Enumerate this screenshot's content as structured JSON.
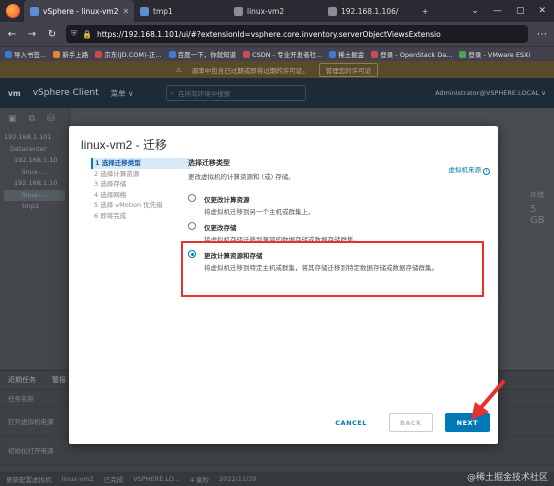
{
  "browser": {
    "tabs": [
      {
        "label": "vSphere - linux-vm2",
        "active": true
      },
      {
        "label": "tmp1"
      },
      {
        "label": "linux-vm2"
      },
      {
        "label": "192.168.1.106/"
      }
    ],
    "new_tab": "+",
    "window_controls": [
      "⌄",
      "—",
      "▢",
      "✕"
    ],
    "url": "https://192.168.1.101/ui/#?extensionId=vsphere.core.inventory.serverObjectViewsExtensio",
    "bookmarks": [
      "导入书签...",
      "新手上路",
      "京东(JD.COM)-正...",
      "百度一下，你就知道",
      "CSDN - 专业开发者社...",
      "稀土掘金",
      "登录 - OpenStack Da...",
      "登录 - VMware ESXi"
    ]
  },
  "app": {
    "logo": "vm",
    "title": "vSphere Client",
    "menu": "菜单 ∨",
    "search_placeholder": "在所有环境中搜索",
    "user": "Administrator@VSPHERE.LOCAL ∨",
    "banner_text": "调率中包含已过期或即将过期的许可证。",
    "banner_button": "管理您的许可证",
    "tree": [
      "192.168.1.101",
      "Datacenter",
      "192.168.1.10",
      "linux-...",
      "192.168.1.10",
      "linux-...",
      "tmp1"
    ],
    "right_text": [
      "存储",
      "5 GB"
    ],
    "recent_tabs": [
      "近期任务",
      "警报"
    ],
    "recent_col": "任务名称",
    "recent_rows": [
      "打开虚拟机电源",
      "初始化打开电源"
    ],
    "bottom_row": [
      "更新配置虚拟机",
      "linux-vm2",
      "已完成",
      "VSPHERE.LO...",
      "4 毫秒",
      "2022/11/20"
    ]
  },
  "modal": {
    "title": "linux-vm2 - 迁移",
    "steps": [
      "1 选择迁移类型",
      "2 选择计算资源",
      "3 选择存储",
      "4 选择网络",
      "5 选择 vMotion 优先级",
      "6 即将完成"
    ],
    "heading": "选择迁移类型",
    "subheading": "更改虚拟机的计算资源和 (或) 存储。",
    "link": "虚拟机来源",
    "options": [
      {
        "title": "仅更改计算资源",
        "desc": "将虚拟机迁移到另一个主机或群集上。",
        "selected": false
      },
      {
        "title": "仅更改存储",
        "desc": "将虚拟机存储迁移到兼容的数据存储或数据存储群集。",
        "selected": false
      },
      {
        "title": "更改计算资源和存储",
        "desc": "将虚拟机迁移到特定主机或群集，将其存储迁移到特定数据存储或数据存储群集。",
        "selected": true
      }
    ],
    "buttons": {
      "cancel": "CANCEL",
      "back": "BACK",
      "next": "NEXT"
    }
  },
  "watermark": "@稀土掘金技术社区",
  "colors": {
    "accent": "#0079b8",
    "highlight": "#e8302c"
  }
}
